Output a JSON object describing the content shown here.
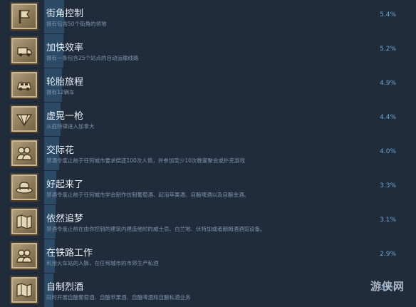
{
  "achievements": [
    {
      "title": "街角控制",
      "desc": "拥有包含50个街角的领地",
      "pct": "5.4%",
      "progress": 0.054,
      "icon": "flag-icon"
    },
    {
      "title": "加快效率",
      "desc": "拥有一条包含25个站点的自动运输线路",
      "pct": "5.2%",
      "progress": 0.052,
      "icon": "truck-icon"
    },
    {
      "title": "轮胎旅程",
      "desc": "拥有12辆车",
      "pct": "4.9%",
      "progress": 0.049,
      "icon": "car-icon"
    },
    {
      "title": "虚晃一枪",
      "desc": "从底特律进入加拿大",
      "pct": "4.4%",
      "progress": 0.044,
      "icon": "diamond-icon"
    },
    {
      "title": "交际花",
      "desc": "禁酒令废止前于任何城市要求偿还100次人情，并参加至少10次晚宴聚会或扑克游戏",
      "pct": "4.0%",
      "progress": 0.04,
      "icon": "people-icon"
    },
    {
      "title": "好起来了",
      "desc": "禁酒令废止前于任何城市学会制作仿制葡萄酒、起泡苹果酒、自酿啤酒以及自酿金酒。",
      "pct": "3.3%",
      "progress": 0.033,
      "icon": "hat-icon"
    },
    {
      "title": "依然追梦",
      "desc": "禁酒令废止前在由你控制的建筑内建造他时的威士忌、白兰地、伏特加或者朗姆酒酒馆设备。",
      "pct": "3.1%",
      "progress": 0.031,
      "icon": "map-icon"
    },
    {
      "title": "在铁路工作",
      "desc": "利用火车站的人脉，在任何城市的市郊生产私酒",
      "pct": "2.9%",
      "progress": 0.029,
      "icon": "people-icon"
    },
    {
      "title": "自制烈酒",
      "desc": "同时开展自酿葡萄酒、自酿苹果酒、自酿啤酒和自酿私酒业务",
      "pct": "2.6%",
      "progress": 0.026,
      "icon": "map-icon"
    }
  ],
  "watermark": "游侠网"
}
